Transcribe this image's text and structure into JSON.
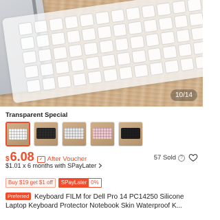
{
  "gallery": {
    "counter": "10/14"
  },
  "variants": {
    "label": "Transparent Special",
    "options": [
      {
        "bg": "#cfb08a",
        "keys": "#f4f4f4",
        "selected": true
      },
      {
        "bg": "#cfb08a",
        "keys": "#2b2b2b",
        "selected": false
      },
      {
        "bg": "#cfb08a",
        "keys": "#e6e6e6",
        "selected": false
      },
      {
        "bg": "#cfb08a",
        "keys": "#f3c6cf",
        "selected": false
      },
      {
        "bg": "#cfb08a",
        "keys": "#1f1f1f",
        "selected": false
      }
    ]
  },
  "price": {
    "currency": "$",
    "amount": "6.08",
    "voucher_label": "After Voucher",
    "sold": "57 Sold",
    "installment": "$1.01 x 6 months with SPayLater"
  },
  "tags": {
    "voucher": "Buy $19 get $1 off",
    "spay_name": "SPayLater",
    "spay_rate": "0%"
  },
  "product": {
    "badge": "Preferred",
    "title": "Keyboard FILM for Dell Pro 14 PC14250 Silicone Laptop Keyboard Protector Notebook Skin Waterproof K..."
  },
  "colors": {
    "accent": "#ee4d2d"
  },
  "icons": {
    "voucher": "voucher-icon",
    "help": "question-circle-icon",
    "favorite": "heart-icon",
    "installment_more": "chevron-right-icon"
  }
}
